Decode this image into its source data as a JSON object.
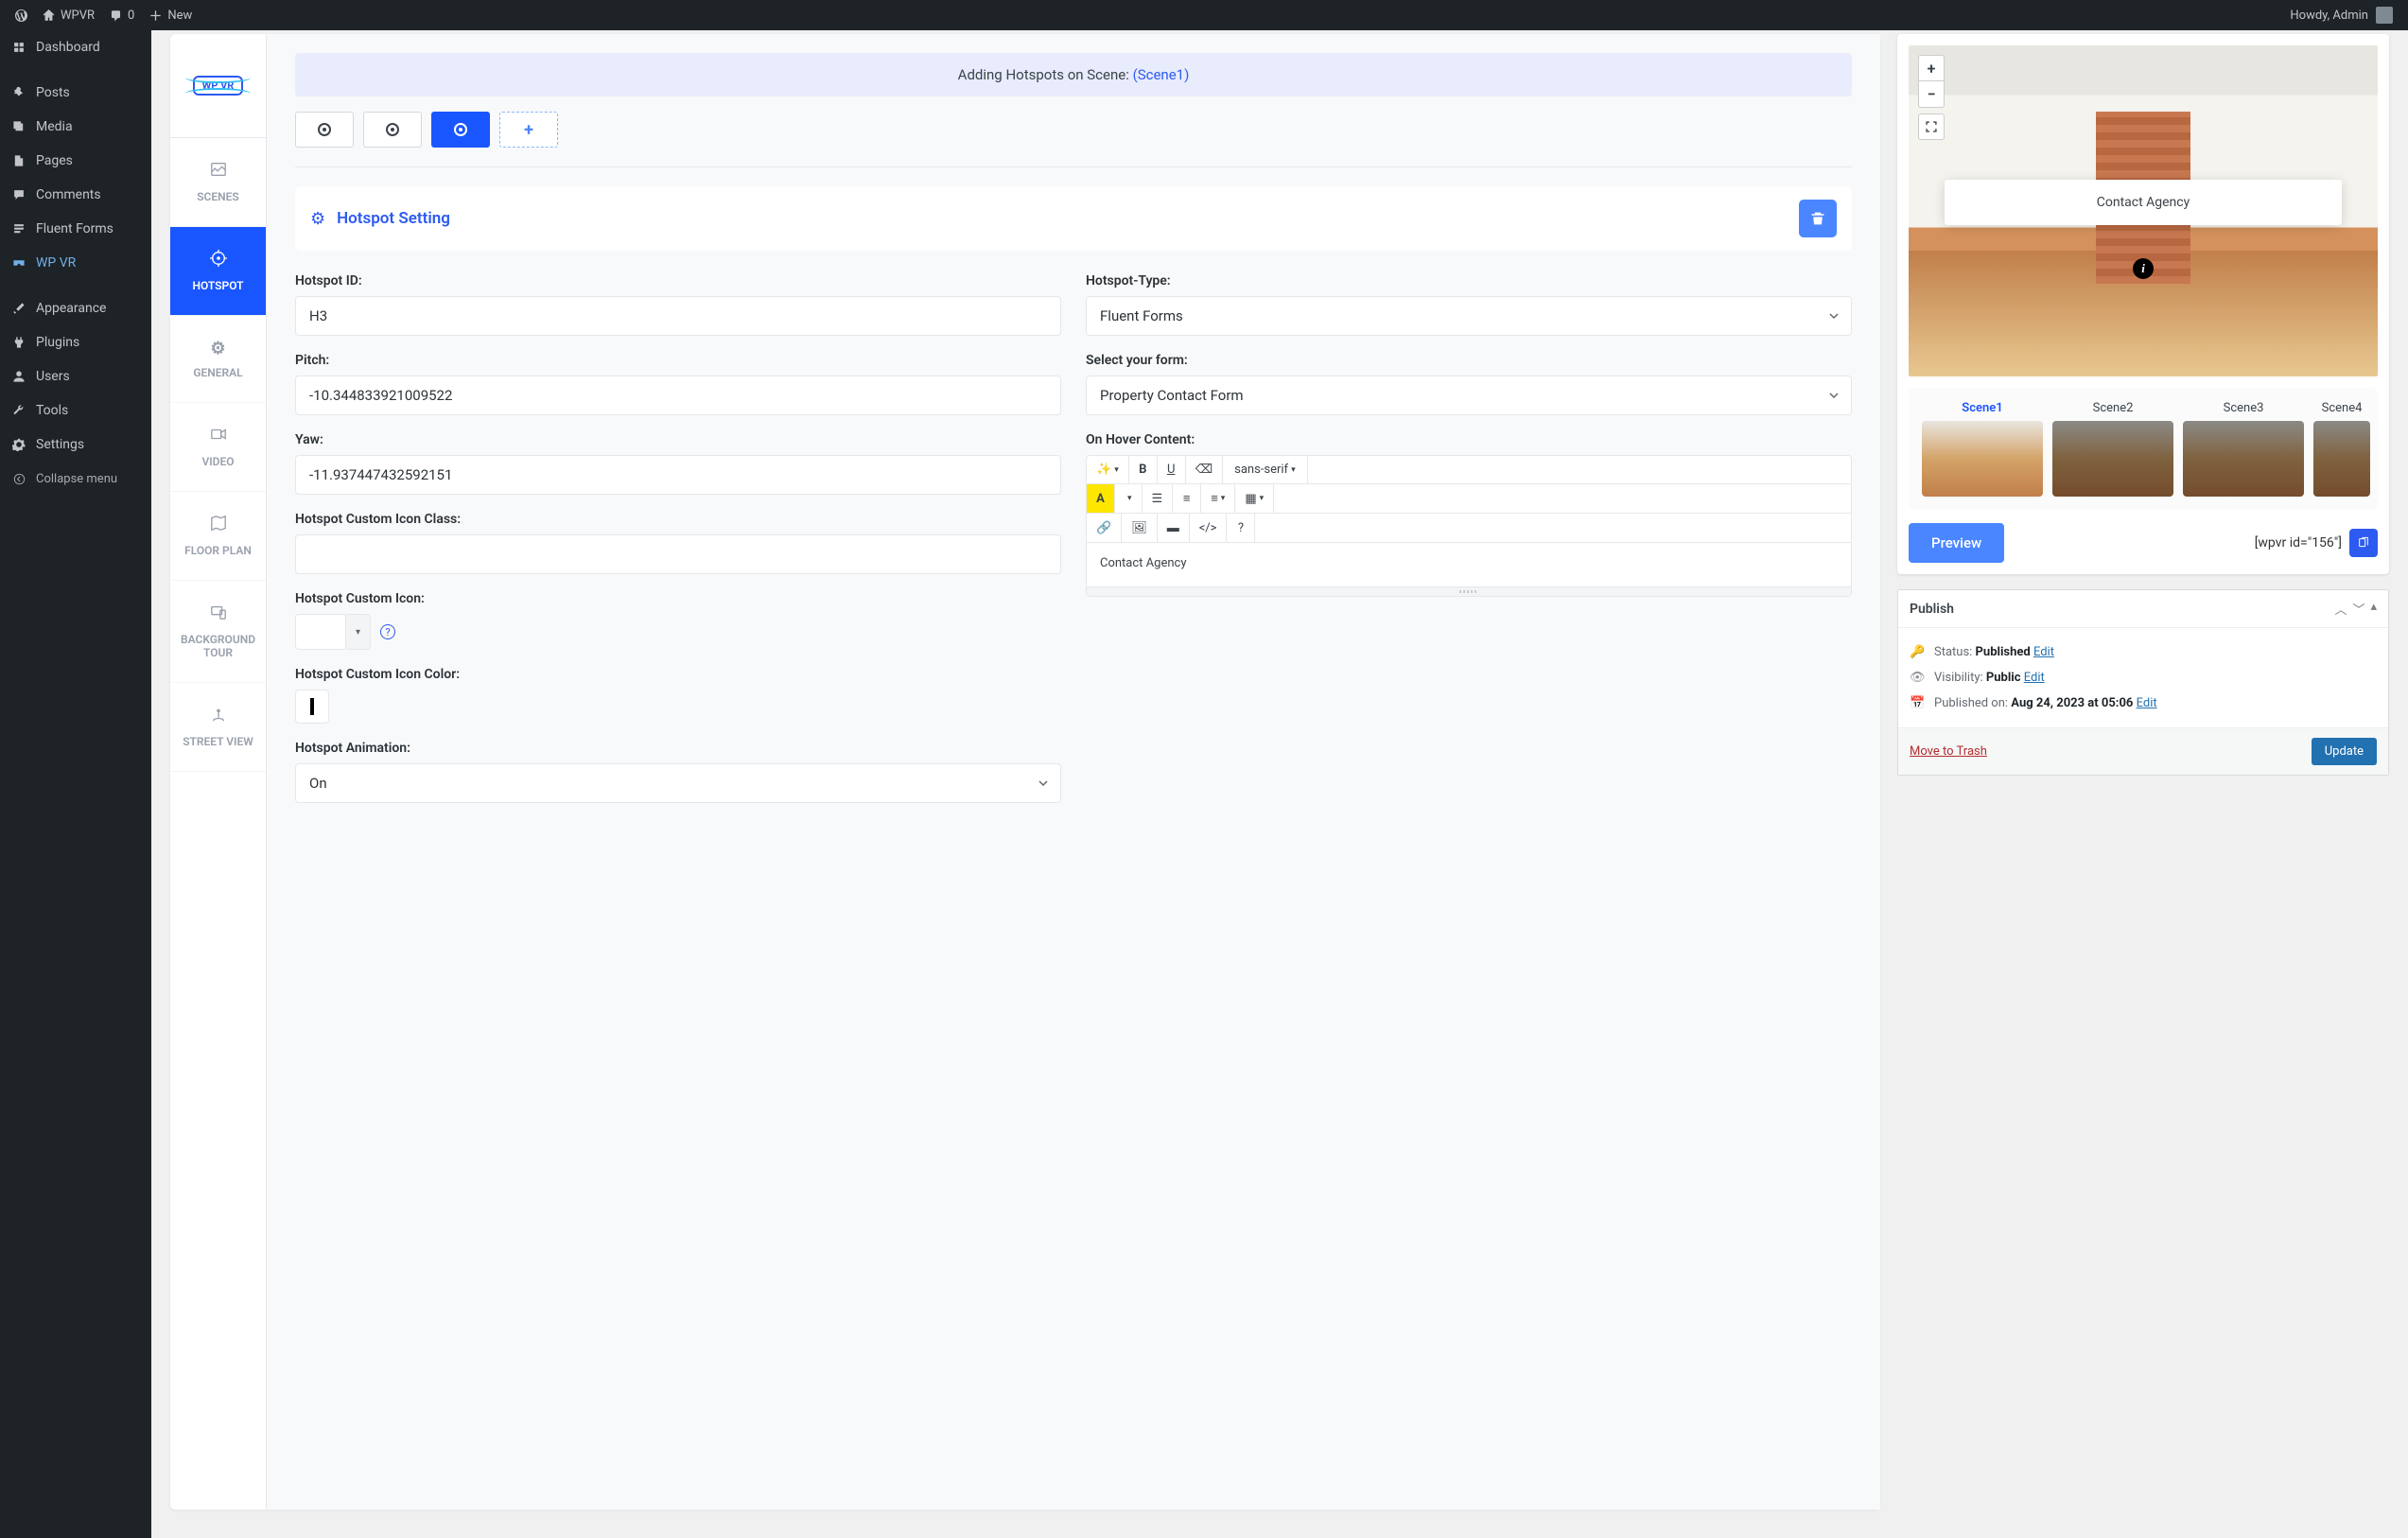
{
  "adminbar": {
    "site_name": "WPVR",
    "comments": "0",
    "new": "New",
    "howdy": "Howdy, Admin"
  },
  "sidebar": {
    "items": [
      {
        "label": "Dashboard",
        "icon": "dashboard"
      },
      {
        "label": "Posts",
        "icon": "pin"
      },
      {
        "label": "Media",
        "icon": "media"
      },
      {
        "label": "Pages",
        "icon": "page"
      },
      {
        "label": "Comments",
        "icon": "comment"
      },
      {
        "label": "Fluent Forms",
        "icon": "forms"
      },
      {
        "label": "WP VR",
        "icon": "vr"
      },
      {
        "label": "Appearance",
        "icon": "brush"
      },
      {
        "label": "Plugins",
        "icon": "plugin"
      },
      {
        "label": "Users",
        "icon": "user"
      },
      {
        "label": "Tools",
        "icon": "wrench"
      },
      {
        "label": "Settings",
        "icon": "cog"
      }
    ],
    "collapse": "Collapse menu"
  },
  "vtabs": {
    "scenes": "SCENES",
    "hotspot": "HOTSPOT",
    "general": "GENERAL",
    "video": "VIDEO",
    "floorplan": "FLOOR PLAN",
    "bgtour": "BACKGROUND TOUR",
    "streetview": "STREET VIEW"
  },
  "banner": {
    "text": "Adding Hotspots on Scene: ",
    "scene": "(Scene1)"
  },
  "section_title": "Hotspot Setting",
  "fields": {
    "hotspot_id_label": "Hotspot ID:",
    "hotspot_id": "H3",
    "hotspot_type_label": "Hotspot-Type:",
    "hotspot_type": "Fluent Forms",
    "pitch_label": "Pitch:",
    "pitch": "-10.344833921009522",
    "select_form_label": "Select your form:",
    "select_form": "Property Contact Form",
    "yaw_label": "Yaw:",
    "yaw": "-11.937447432592151",
    "hover_label": "On Hover Content:",
    "hover_content": "Contact Agency",
    "icon_class_label": "Hotspot Custom Icon Class:",
    "icon_class": "",
    "icon_label": "Hotspot Custom Icon:",
    "icon_color_label": "Hotspot Custom Icon Color:",
    "animation_label": "Hotspot Animation:",
    "animation": "On",
    "font_family": "sans-serif"
  },
  "preview": {
    "tooltip": "Contact Agency",
    "scenes": [
      "Scene1",
      "Scene2",
      "Scene3",
      "Scene4"
    ],
    "button": "Preview",
    "shortcode": "[wpvr id=\"156\"]"
  },
  "publish": {
    "title": "Publish",
    "status_label": "Status: ",
    "status": "Published",
    "visibility_label": "Visibility: ",
    "visibility": "Public",
    "date_label": "Published on: ",
    "date": "Aug 24, 2023 at 05:06",
    "edit": "Edit",
    "trash": "Move to Trash",
    "update": "Update"
  }
}
